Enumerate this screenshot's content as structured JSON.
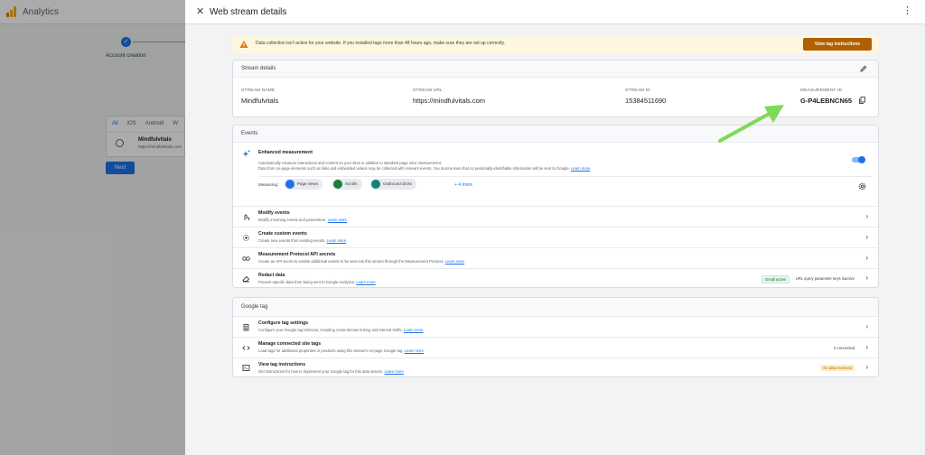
{
  "background_app": {
    "title": "Analytics",
    "step_label": "Account creation",
    "step_check": "✓",
    "tabs": [
      "All",
      "iOS",
      "Android",
      "W"
    ],
    "stream_name": "Mindfulvitals",
    "stream_url": "https://mindfulvitals.com",
    "next_button": "Next"
  },
  "drawer": {
    "title": "Web stream details",
    "close_icon": "✕",
    "more_icon": "⋮"
  },
  "alert": {
    "text": "Data collection isn't active for your website. If you installed tags more than 48 hours ago, make sure they are set up correctly.",
    "button": "View tag instructions"
  },
  "stream_details": {
    "heading": "Stream details",
    "fields": [
      {
        "label": "STREAM NAME",
        "value": "Mindfulvitals"
      },
      {
        "label": "STREAM URL",
        "value": "https://mindfulvitals.com"
      },
      {
        "label": "STREAM ID",
        "value": "15384511690"
      },
      {
        "label": "MEASUREMENT ID",
        "value": "G-P4LEBNCN65"
      }
    ]
  },
  "events": {
    "heading": "Events",
    "enhanced": {
      "title": "Enhanced measurement",
      "desc1": "Automatically measure interactions and content on your sites in addition to standard page view measurement.",
      "desc2": "Data from on-page elements such as links and embedded videos may be collected with relevant events. You must ensure that no personally-identifiable information will be sent to Google.",
      "learn_more": "Learn more",
      "measuring_label": "Measuring:",
      "pills": [
        "Page views",
        "Scrolls",
        "Outbound clicks"
      ],
      "more": "+ 4 more",
      "enabled": true
    },
    "rows": [
      {
        "title": "Modify events",
        "desc": "Modify incoming events and parameters.",
        "learn": "Learn more"
      },
      {
        "title": "Create custom events",
        "desc": "Create new events from existing events.",
        "learn": "Learn more"
      },
      {
        "title": "Measurement Protocol API secrets",
        "desc": "Create an API secret to enable additional events to be sent into this stream through the Measurement Protocol.",
        "learn": "Learn more"
      },
      {
        "title": "Redact data",
        "desc": "Prevent specific data from being sent to Google Analytics.",
        "learn": "Learn more",
        "badge": "Email active",
        "badge2": "URL query parameter keys inactive"
      }
    ]
  },
  "google_tag": {
    "heading": "Google tag",
    "rows": [
      {
        "title": "Configure tag settings",
        "desc": "Configure your Google tag behavior, including cross-domain linking and internal traffic.",
        "learn": "Learn more"
      },
      {
        "title": "Manage connected site tags",
        "desc": "Load tags for additional properties or products using this stream's on-page Google tag.",
        "learn": "Learn more",
        "status": "0 connected"
      },
      {
        "title": "View tag instructions",
        "desc": "Get instructions for how to implement your Google tag for this data stream.",
        "learn": "Learn more",
        "status": "No data received"
      }
    ]
  },
  "colors": {
    "accent": "#1a73e8",
    "warning_button": "#b06000",
    "alert_bg": "#fef7e0",
    "annotation_arrow": "#7ed957"
  },
  "chevron": "›"
}
